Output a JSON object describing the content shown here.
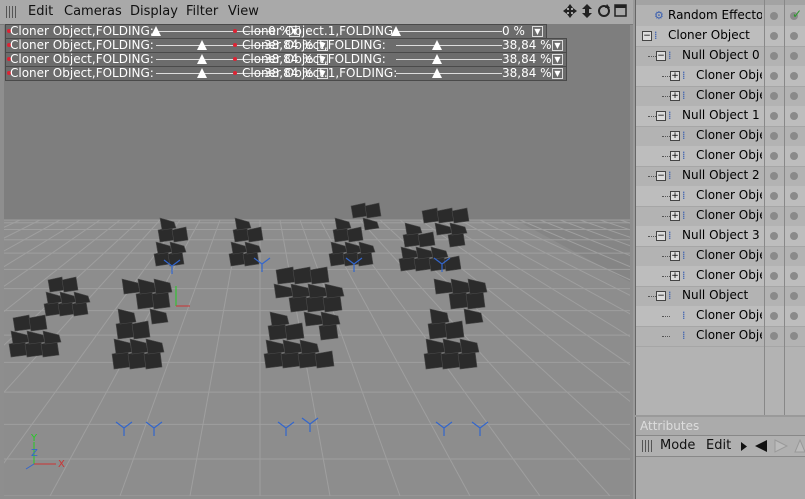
{
  "menu": {
    "items": [
      "Edit",
      "Cameras",
      "Display",
      "Filter",
      "View"
    ]
  },
  "nav_icons": [
    "move-icon",
    "pan-icon",
    "rotate-icon",
    "maximize-icon"
  ],
  "hud": {
    "rows": [
      {
        "left_label": "Cloner Object,FOLDING:",
        "left_value": "0 %",
        "left_fraction": 0.0,
        "right_label": "Cloner Object.1,FOLDING:",
        "right_value": "0 %",
        "right_fraction": 0.0
      },
      {
        "left_label": "Cloner Object,FOLDING:",
        "left_value": "38,84 %",
        "left_fraction": 0.3884,
        "right_label": "Cloner Object,FOLDING:",
        "right_value": "38,84 %",
        "right_fraction": 0.3884
      },
      {
        "left_label": "Cloner Object,FOLDING:",
        "left_value": "38,84 %",
        "left_fraction": 0.3884,
        "right_label": "Cloner Object,FOLDING:",
        "right_value": "38,84 %",
        "right_fraction": 0.3884
      },
      {
        "left_label": "Cloner Object,FOLDING:",
        "left_value": "38,84 %",
        "left_fraction": 0.3884,
        "right_label": "Cloner Object.1,FOLDING:",
        "right_value": "38,84 %",
        "right_fraction": 0.3884
      }
    ]
  },
  "objects": [
    {
      "label": "Random Effector",
      "depth": 0,
      "expander": "",
      "icon": "effector-icon",
      "checked": true
    },
    {
      "label": "Cloner Object",
      "depth": 0,
      "expander": "−",
      "icon": "cloner-icon",
      "checked": false
    },
    {
      "label": "Null Object 0",
      "depth": 1,
      "expander": "−",
      "icon": "null-icon",
      "checked": false
    },
    {
      "label": "Cloner Object",
      "depth": 2,
      "expander": "+",
      "icon": "cloner-icon",
      "checked": false
    },
    {
      "label": "Cloner Object",
      "depth": 2,
      "expander": "+",
      "icon": "cloner-icon",
      "checked": false
    },
    {
      "label": "Null Object 1",
      "depth": 1,
      "expander": "−",
      "icon": "null-icon",
      "checked": false
    },
    {
      "label": "Cloner Object",
      "depth": 2,
      "expander": "+",
      "icon": "cloner-icon",
      "checked": false
    },
    {
      "label": "Cloner Object",
      "depth": 2,
      "expander": "+",
      "icon": "cloner-icon",
      "checked": false
    },
    {
      "label": "Null Object 2",
      "depth": 1,
      "expander": "−",
      "icon": "null-icon",
      "checked": false
    },
    {
      "label": "Cloner Object",
      "depth": 2,
      "expander": "+",
      "icon": "cloner-icon",
      "checked": false
    },
    {
      "label": "Cloner Object",
      "depth": 2,
      "expander": "+",
      "icon": "cloner-icon",
      "checked": false
    },
    {
      "label": "Null Object 3",
      "depth": 1,
      "expander": "−",
      "icon": "null-icon",
      "checked": false
    },
    {
      "label": "Cloner Object",
      "depth": 2,
      "expander": "+",
      "icon": "cloner-icon",
      "checked": false
    },
    {
      "label": "Cloner Object",
      "depth": 2,
      "expander": "+",
      "icon": "cloner-icon",
      "checked": false
    },
    {
      "label": "Null Object",
      "depth": 1,
      "expander": "−",
      "icon": "null-icon",
      "checked": false
    },
    {
      "label": "Cloner Object",
      "depth": 2,
      "expander": "",
      "icon": "cloner-icon",
      "checked": false
    },
    {
      "label": "Cloner Object",
      "depth": 2,
      "expander": "",
      "icon": "cloner-icon",
      "checked": false
    }
  ],
  "attributes": {
    "title": "Attributes",
    "mode_label": "Mode",
    "edit_label": "Edit"
  },
  "axes": {
    "y": "Y",
    "z": "Z",
    "x": "X"
  },
  "colors": {
    "grid": "#9c9c9c",
    "floor": "#8a8a8a",
    "object": "#2b2b2b",
    "axis_x": "#c33",
    "axis_y": "#2c2",
    "axis_z": "#36c"
  }
}
